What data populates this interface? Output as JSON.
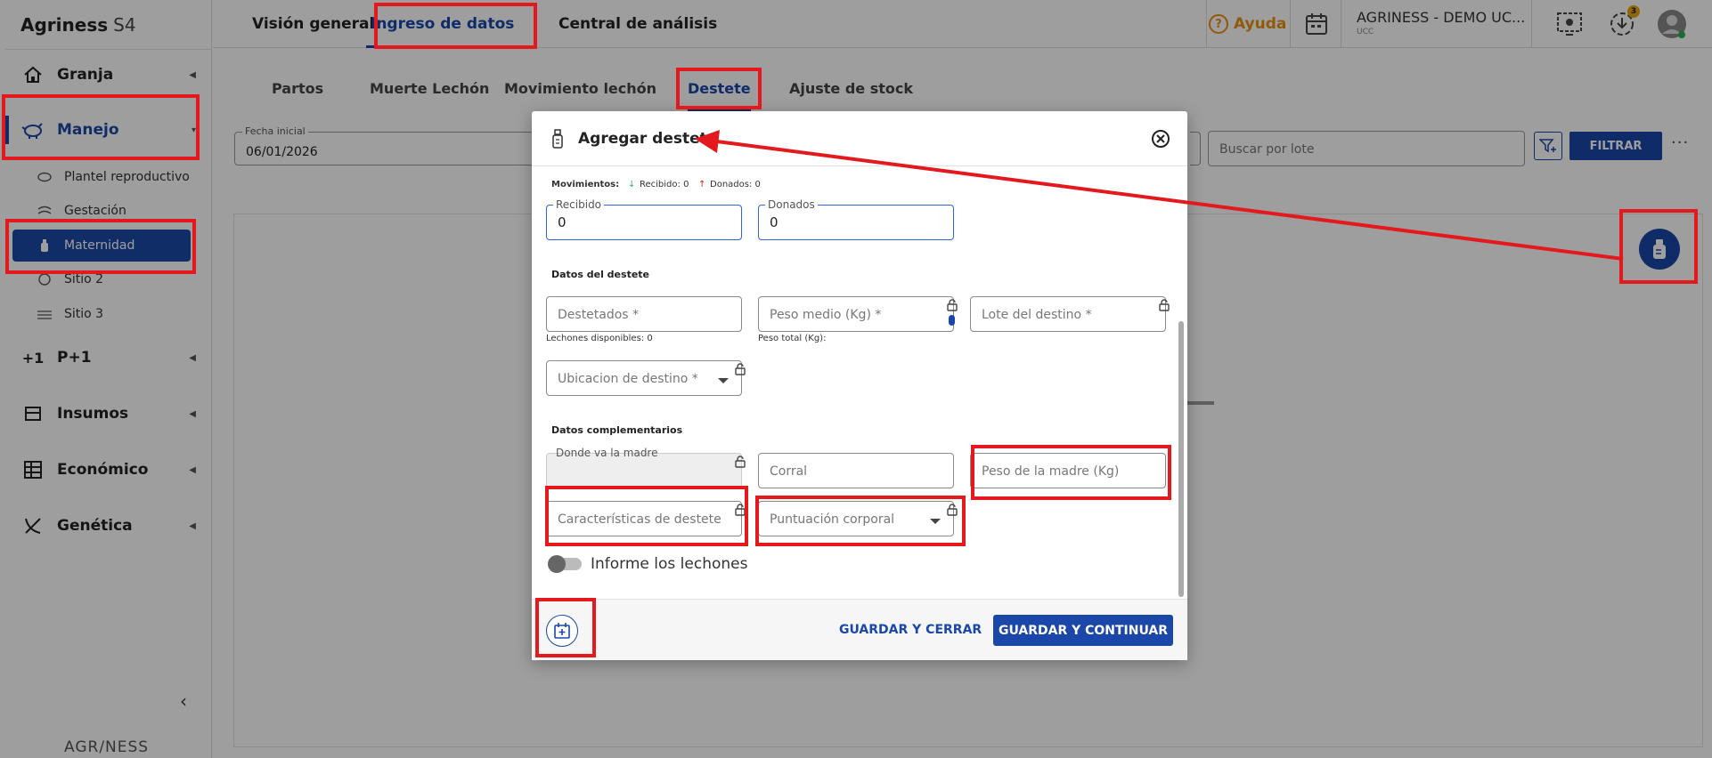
{
  "brand": {
    "name": "Agriness",
    "version": "S4"
  },
  "top_tabs": [
    "Visión general",
    "Ingreso de datos",
    "Central de análisis"
  ],
  "help_label": "Ayuda",
  "company": {
    "name": "AGRINESS - DEMO UC...",
    "sub": "UCC"
  },
  "notification_count": "3",
  "sidebar": {
    "items": [
      {
        "label": "Granja"
      },
      {
        "label": "Manejo"
      },
      {
        "label": "P+1"
      },
      {
        "label": "Insumos"
      },
      {
        "label": "Económico"
      },
      {
        "label": "Genética"
      }
    ],
    "sub_items": [
      {
        "label": "Plantel reproductivo"
      },
      {
        "label": "Gestación"
      },
      {
        "label": "Maternidad"
      },
      {
        "label": "Sitio 2"
      },
      {
        "label": "Sitio 3"
      }
    ],
    "footer_logo": "AGR/NESS"
  },
  "sub_tabs": [
    "Partos",
    "Muerte Lechón",
    "Movimiento lechón",
    "Destete",
    "Ajuste de stock"
  ],
  "filters": {
    "fecha_label": "Fecha inicial",
    "fecha_value": "06/01/2026",
    "lote_placeholder": "Buscar por lote",
    "filtrar": "FILTRAR"
  },
  "modal": {
    "title": "Agregar destete",
    "movimientos_label": "Movimientos:",
    "recibido_summary": "Recibido: 0",
    "donados_summary": "Donados: 0",
    "recibido_label": "Recibido",
    "recibido_value": "0",
    "donados_label": "Donados",
    "donados_value": "0",
    "section_destete": "Datos del destete",
    "destetados": "Destetados *",
    "peso_medio": "Peso medio (Kg) *",
    "lote_destino": "Lote del destino *",
    "lechones_disponibles": "Lechones disponibles: 0",
    "peso_total": "Peso total (Kg):",
    "ubicacion_destino": "Ubicacion de destino *",
    "section_complementarios": "Datos complementarios",
    "donde_madre": "Donde va la madre",
    "corral": "Corral",
    "peso_madre": "Peso de la madre (Kg)",
    "caracteristicas": "Características de destete",
    "puntuacion": "Puntuación corporal",
    "informe_lechones": "Informe los lechones",
    "guardar_cerrar": "GUARDAR Y CERRAR",
    "guardar_continuar": "GUARDAR Y CONTINUAR"
  },
  "colors": {
    "accent": "#1a47a8",
    "annotation": "#e3191d",
    "help": "#e8910e"
  }
}
